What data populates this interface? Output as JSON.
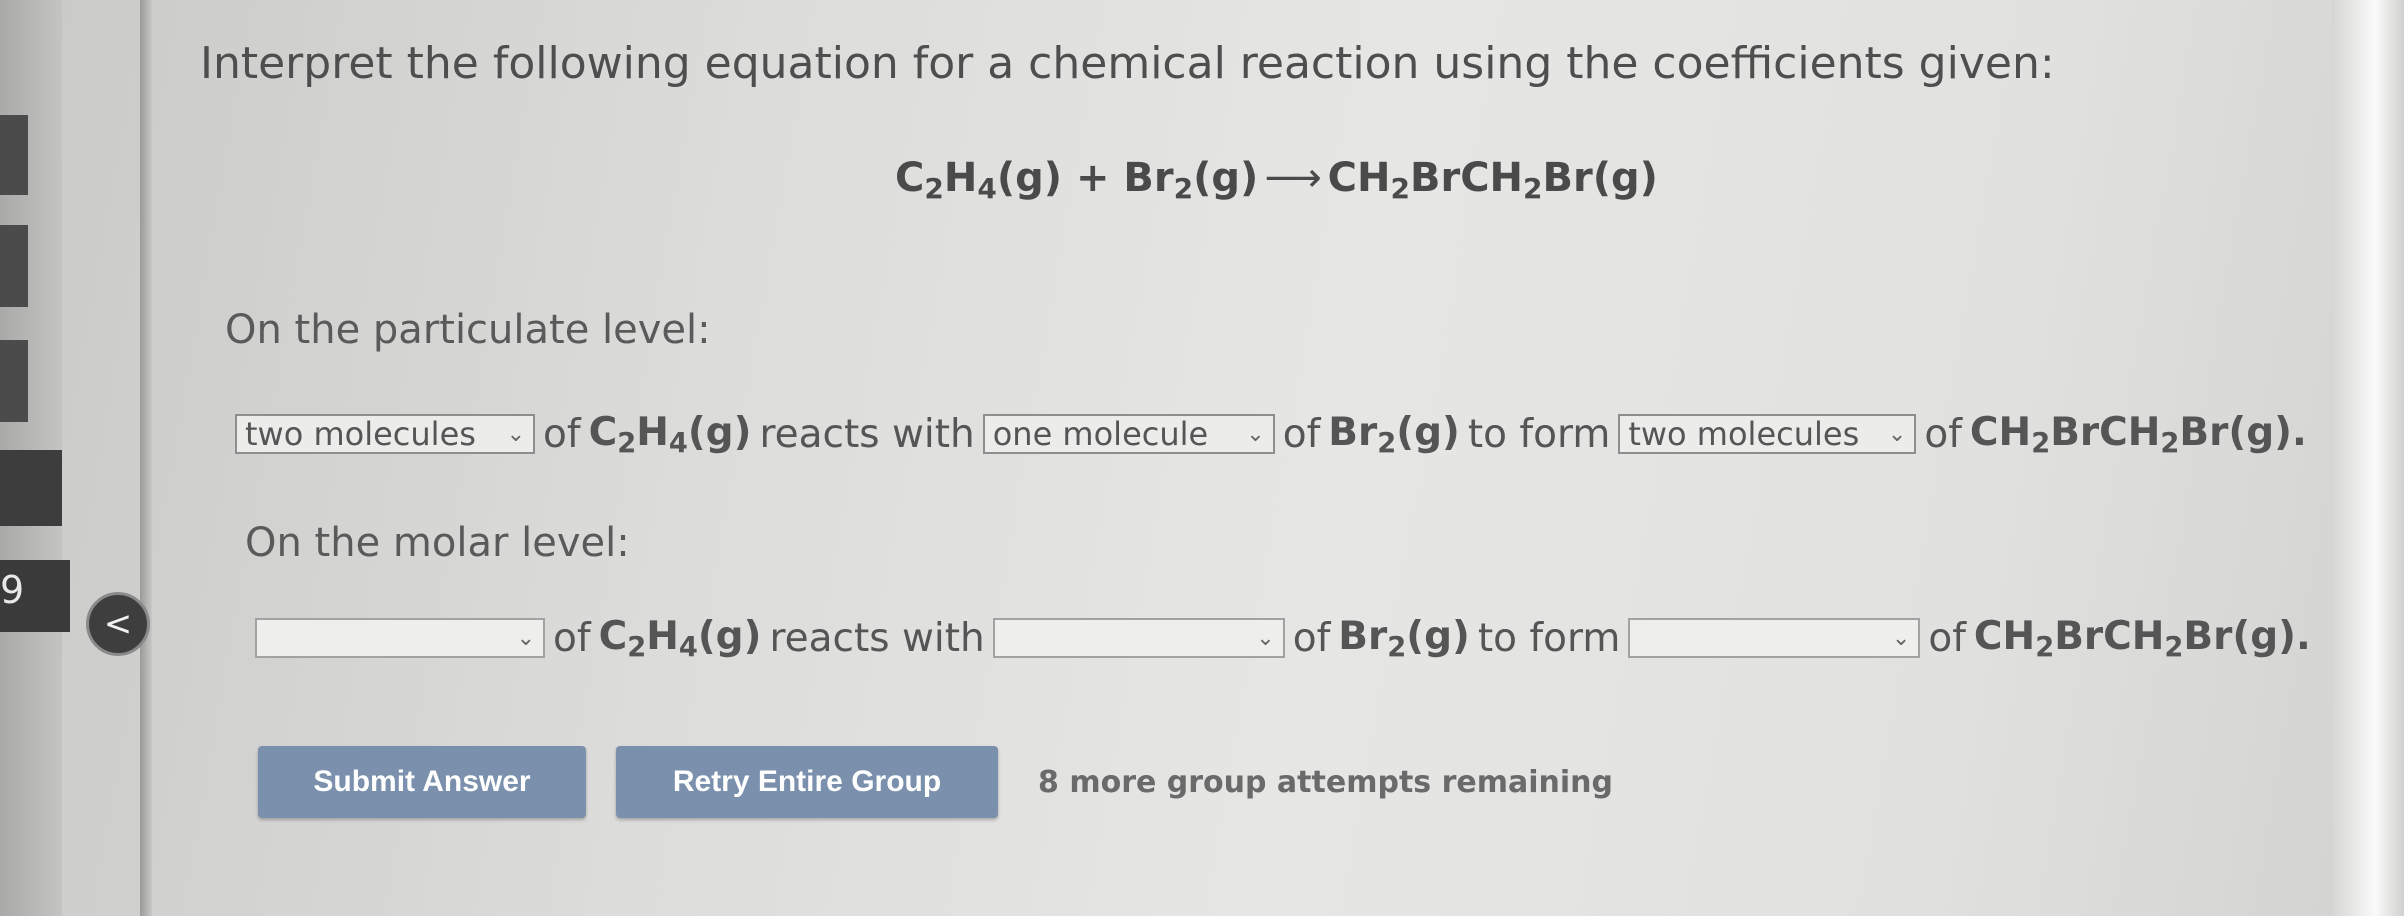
{
  "question": "Interpret the following equation for a chemical reaction using the coefficients given:",
  "equation": {
    "r1": "C",
    "r1s1": "2",
    "r1b": "H",
    "r1s2": "4",
    "r1c": "(g)",
    "plus": "+",
    "r2": "Br",
    "r2s": "2",
    "r2c": "(g)",
    "arrow": "⟶",
    "p1": "CH",
    "p1s1": "2",
    "p1b": "BrCH",
    "p1s2": "2",
    "p1c": "Br(g)"
  },
  "particulate": {
    "label": "On the particulate level:",
    "select1": "two molecules",
    "select2": "one molecule",
    "select3": "two molecules"
  },
  "molar": {
    "label": "On the molar level:",
    "select1": "",
    "select2": "",
    "select3": ""
  },
  "phrases": {
    "of": "of",
    "reacts_with": "reacts with",
    "of2": "of",
    "to_form": "to form",
    "of3": "of"
  },
  "species": {
    "c2h4_a": "C",
    "c2h4_s1": "2",
    "c2h4_b": "H",
    "c2h4_s2": "4",
    "c2h4_c": "(g)",
    "br2_a": "Br",
    "br2_s": "2",
    "br2_c": "(g)",
    "prod_a": "CH",
    "prod_s1": "2",
    "prod_b": "BrCH",
    "prod_s2": "2",
    "prod_c": "Br(g)."
  },
  "buttons": {
    "submit": "Submit Answer",
    "retry": "Retry Entire Group"
  },
  "attempts": "8 more group attempts remaining",
  "sidebar": {
    "number": "9",
    "collapse": "<"
  },
  "icons": {
    "chevron": "chevron-down-icon"
  }
}
